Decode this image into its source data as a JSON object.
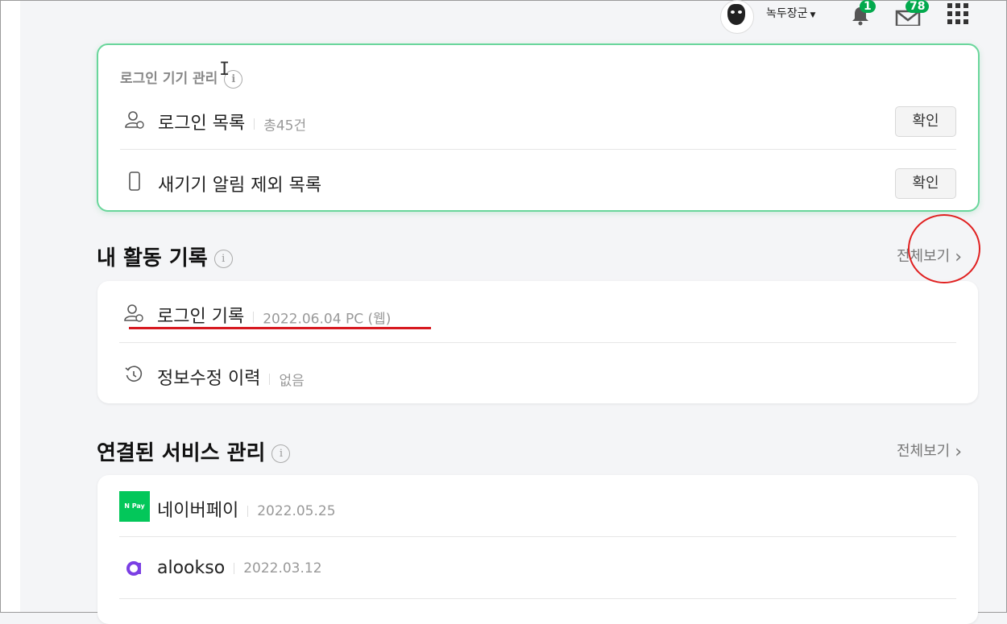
{
  "header": {
    "username": "녹두장군",
    "notifications_count": "1",
    "mail_count": "78"
  },
  "login_device": {
    "title": "로그인 기기 관리",
    "rows": [
      {
        "label": "로그인 목록",
        "meta": "총45건",
        "button": "확인"
      },
      {
        "label": "새기기 알림 제외 목록",
        "button": "확인"
      }
    ]
  },
  "activity": {
    "title": "내 활동 기록",
    "view_all": "전체보기",
    "rows": [
      {
        "label": "로그인 기록",
        "meta": "2022.06.04 PC (웹)"
      },
      {
        "label": "정보수정 이력",
        "meta": "없음"
      }
    ]
  },
  "services": {
    "title": "연결된 서비스 관리",
    "view_all": "전체보기",
    "rows": [
      {
        "label": "네이버페이",
        "meta": "2022.05.25",
        "icon_text": "N Pay"
      },
      {
        "label": "alookso",
        "meta": "2022.03.12"
      }
    ]
  },
  "colors": {
    "accent_green": "#03a94d",
    "card_border_green": "#69d69b",
    "annotation_red": "#d71920",
    "alookso_purple": "#7b3fe4"
  }
}
